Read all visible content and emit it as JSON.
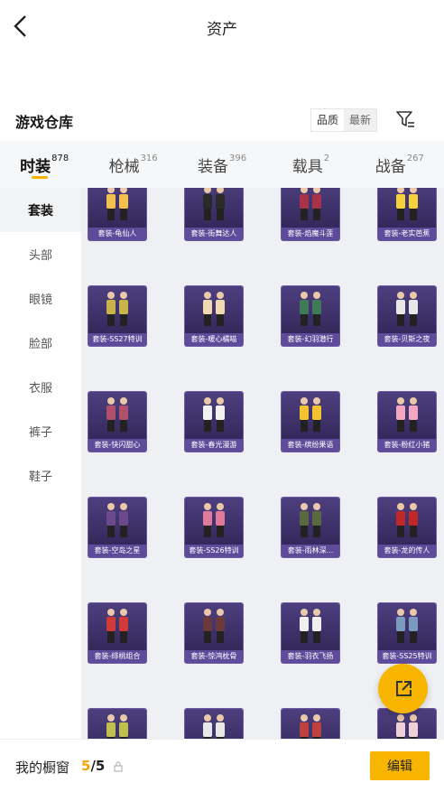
{
  "header": {
    "title": "资产"
  },
  "warehouse": {
    "title": "游戏仓库",
    "sort_options": [
      "品质",
      "最新"
    ],
    "sort_selected": "最新",
    "filter_icon": "filter-icon"
  },
  "tabs": [
    {
      "label": "时装",
      "count": "878",
      "active": true
    },
    {
      "label": "枪械",
      "count": "316",
      "active": false
    },
    {
      "label": "装备",
      "count": "396",
      "active": false
    },
    {
      "label": "载具",
      "count": "2",
      "active": false
    },
    {
      "label": "战备",
      "count": "267",
      "active": false
    }
  ],
  "sidebar": {
    "items": [
      {
        "label": "套装",
        "active": true
      },
      {
        "label": "头部"
      },
      {
        "label": "眼镜"
      },
      {
        "label": "脸部"
      },
      {
        "label": "衣服"
      },
      {
        "label": "裤子"
      },
      {
        "label": "鞋子"
      }
    ]
  },
  "items": [
    {
      "name": "套装-龟仙人",
      "accent": "#f2c14e"
    },
    {
      "name": "套装-街舞达人",
      "accent": "#2a2a2a"
    },
    {
      "name": "套装-焰魔斗莲",
      "accent": "#a8324a"
    },
    {
      "name": "套装-老实芭蕉",
      "accent": "#f5d13a"
    },
    {
      "name": "套装-SS27特训",
      "accent": "#c9b24a"
    },
    {
      "name": "套装-暖心橘喵",
      "accent": "#f0d8b0"
    },
    {
      "name": "套装-幻羽潜行",
      "accent": "#3f7a5a"
    },
    {
      "name": "套装-贝斯之夜",
      "accent": "#e8e8e8"
    },
    {
      "name": "套装-快闪甜心",
      "accent": "#b0506a"
    },
    {
      "name": "套装-春光漫游",
      "accent": "#f2f2f2"
    },
    {
      "name": "套装-缤纷果语",
      "accent": "#f4c430"
    },
    {
      "name": "套装-粉红小猪",
      "accent": "#f4a6c0"
    },
    {
      "name": "套装-空岛之星",
      "accent": "#6a4a8a"
    },
    {
      "name": "套装-SS26特训",
      "accent": "#e07a9a"
    },
    {
      "name": "套装-雨林深...",
      "accent": "#5a6a40"
    },
    {
      "name": "套装-龙的传人",
      "accent": "#c02828"
    },
    {
      "name": "套装-绯桃组合",
      "accent": "#d03a3a"
    },
    {
      "name": "套装-惊鸿枕骨",
      "accent": "#6a3a3a"
    },
    {
      "name": "套装-羽衣飞扬",
      "accent": "#f0f0f0"
    },
    {
      "name": "套装-SS25特训",
      "accent": "#7a9ac0"
    },
    {
      "name": "",
      "accent": "#c0c050"
    },
    {
      "name": "",
      "accent": "#e8e8e8"
    },
    {
      "name": "",
      "accent": "#c04040"
    },
    {
      "name": "",
      "accent": "#f0d0d8"
    }
  ],
  "fab": {
    "icon": "share-external-icon"
  },
  "bottom": {
    "label": "我的橱窗",
    "count_current": "5",
    "count_sep": "/",
    "count_total": "5",
    "lock_icon": "lock-icon",
    "edit_label": "编辑"
  },
  "colors": {
    "accent": "#f7b500",
    "card_bg": "#3a2e64",
    "card_label": "#5e4c9a"
  }
}
